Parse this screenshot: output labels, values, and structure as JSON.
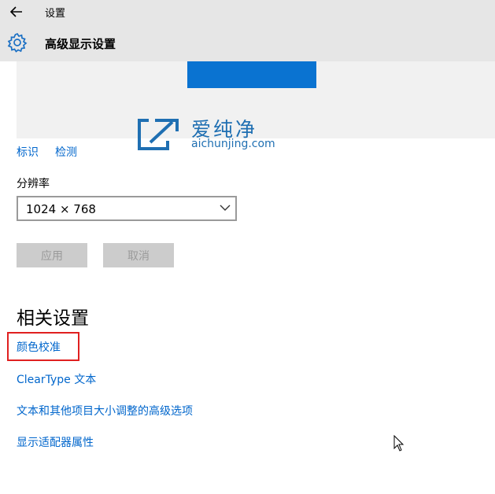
{
  "window": {
    "title": "设置"
  },
  "header": {
    "title": "高级显示设置"
  },
  "display_links": {
    "identify": "标识",
    "detect": "检测"
  },
  "watermark": {
    "brand": "爱纯净",
    "url": "aichunjing.com"
  },
  "resolution": {
    "label": "分辨率",
    "value": "1024 × 768"
  },
  "buttons": {
    "apply": "应用",
    "cancel": "取消"
  },
  "related": {
    "title": "相关设置",
    "links": [
      "颜色校准",
      "ClearType 文本",
      "文本和其他项目大小调整的高级选项",
      "显示适配器属性"
    ]
  },
  "colors": {
    "accent": "#0066cc",
    "monitor": "#0a73d1",
    "highlight_border": "#e02020"
  }
}
